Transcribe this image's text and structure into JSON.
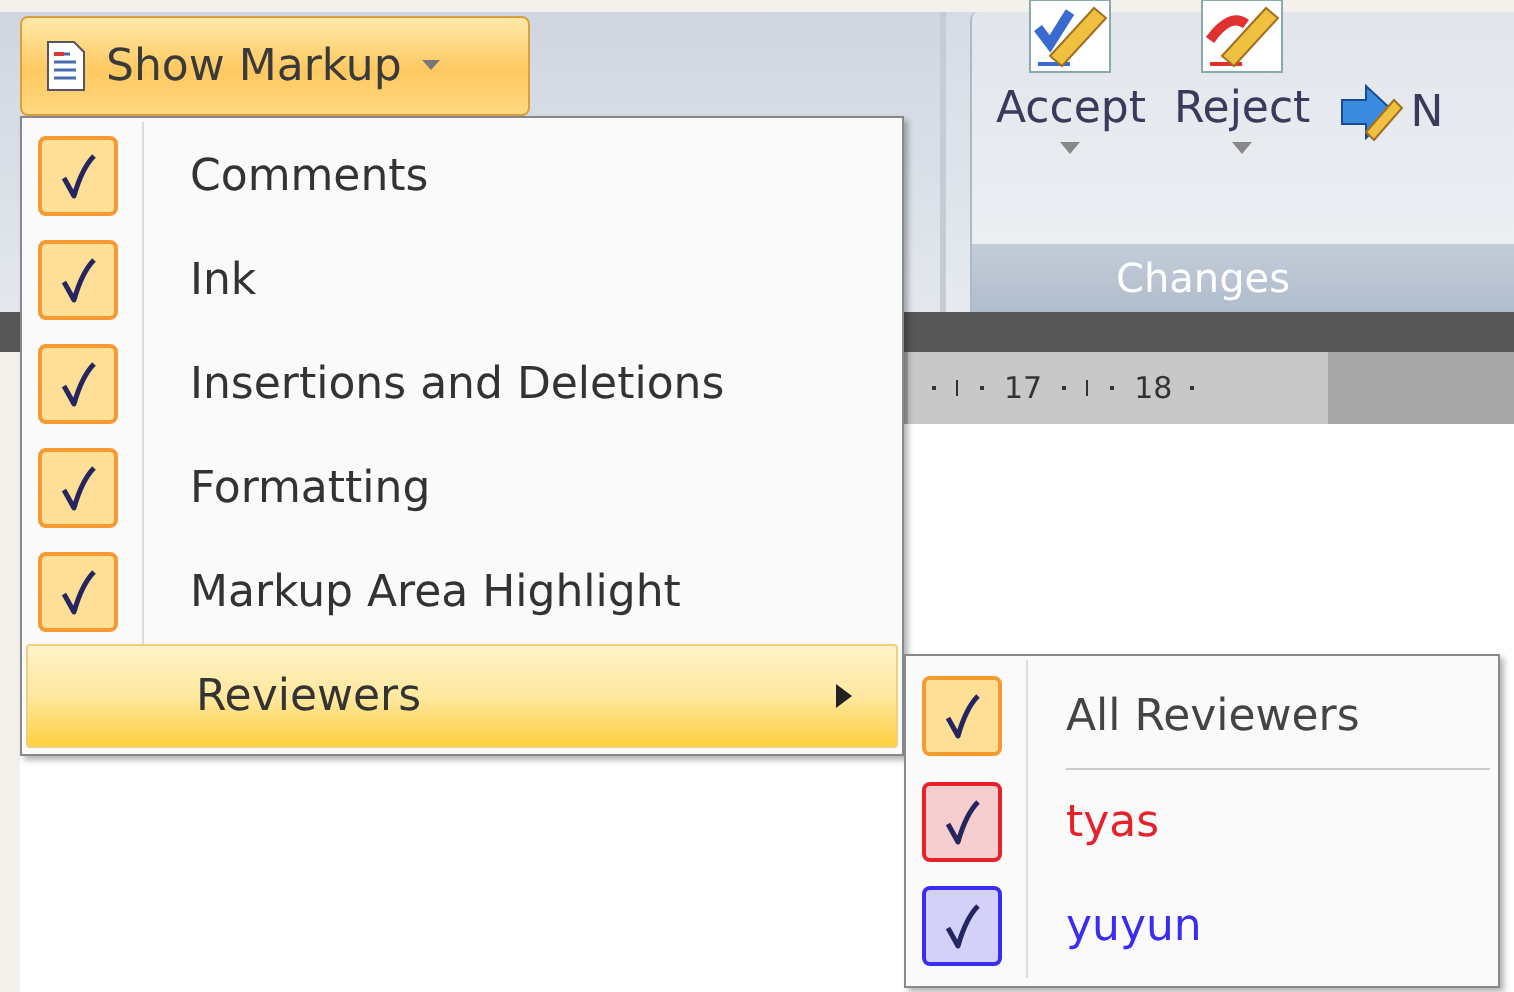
{
  "show_markup_button": {
    "label": "Show Markup"
  },
  "changes_group": {
    "title": "Changes",
    "buttons": [
      {
        "label": "Accept",
        "kind": "accept"
      },
      {
        "label": "Reject",
        "kind": "reject"
      },
      {
        "label": "N",
        "kind": "next"
      }
    ]
  },
  "ruler": {
    "labels": [
      "17",
      "18"
    ]
  },
  "markup_menu": {
    "items": [
      {
        "label": "Comments",
        "checked": true,
        "kind": "check",
        "selected": false
      },
      {
        "label": "Ink",
        "checked": true,
        "kind": "check",
        "selected": false
      },
      {
        "label": "Insertions and Deletions",
        "checked": true,
        "kind": "check",
        "selected": false
      },
      {
        "label": "Formatting",
        "checked": true,
        "kind": "check",
        "selected": false
      },
      {
        "label": "Markup Area Highlight",
        "checked": true,
        "kind": "check",
        "selected": false
      },
      {
        "label": "Reviewers",
        "kind": "submenu",
        "selected": true
      }
    ]
  },
  "reviewers_menu": {
    "items": [
      {
        "label": "All Reviewers",
        "checked": true,
        "kind": "all"
      },
      {
        "label": "tyas",
        "checked": true,
        "kind": "reviewer",
        "color": "#e8202a"
      },
      {
        "label": "yuyun",
        "checked": true,
        "kind": "reviewer",
        "color": "#3a2cf0"
      }
    ]
  }
}
